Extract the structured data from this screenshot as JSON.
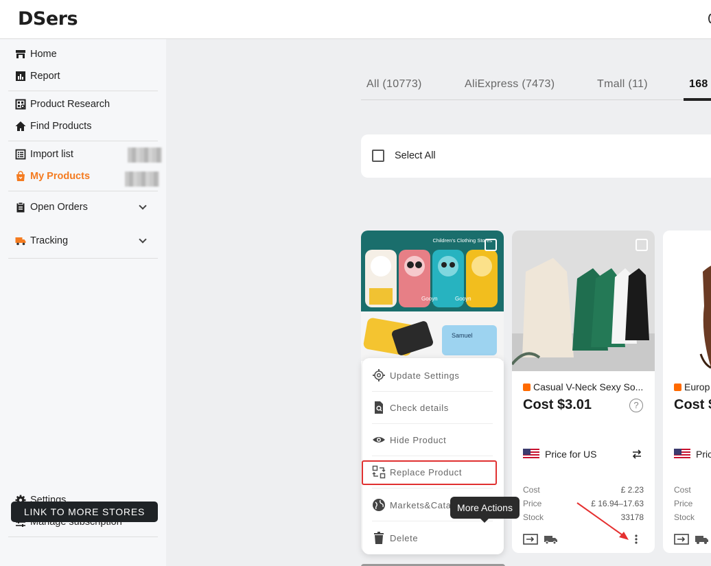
{
  "app": {
    "logo": "DSers"
  },
  "sidebar": {
    "items": [
      {
        "label": "Home",
        "icon": "store-icon"
      },
      {
        "label": "Report",
        "icon": "report-icon"
      },
      {
        "label": "Product Research",
        "icon": "research-icon"
      },
      {
        "label": "Find Products",
        "icon": "house-icon"
      },
      {
        "label": "Import list",
        "icon": "list-icon"
      },
      {
        "label": "My Products",
        "icon": "bag-icon",
        "active": true
      },
      {
        "label": "Open Orders",
        "icon": "clipboard-icon"
      },
      {
        "label": "Tracking",
        "icon": "truck-icon"
      }
    ],
    "settings_label": "Settings",
    "subscription_label": "Manage subscription",
    "link_stores_label": "LINK TO MORE STORES"
  },
  "tabs": [
    {
      "label": "All (10773)"
    },
    {
      "label": "AliExpress (7473)"
    },
    {
      "label": "Tmall (11)"
    },
    {
      "label": "168",
      "active": true
    }
  ],
  "toolbar": {
    "select_all_label": "Select All"
  },
  "menu": {
    "items": [
      {
        "label": "Update Settings",
        "icon": "gear-outline-icon"
      },
      {
        "label": "Check details",
        "icon": "document-search-icon"
      },
      {
        "label": "Hide Product",
        "icon": "eye-icon"
      },
      {
        "label": "Replace Product",
        "icon": "swap-icon"
      },
      {
        "label": "Markets&Cata",
        "icon": "globe-icon"
      },
      {
        "label": "Delete",
        "icon": "trash-icon"
      }
    ]
  },
  "tooltip": "More Actions",
  "cards": [
    {
      "image_caption": "Children's Clothing Stores",
      "image_stamp_brand": "Gooyn",
      "image_mask_name": "Samuel"
    },
    {
      "title": "Casual V-Neck Sexy So...",
      "cost": "Cost $3.01",
      "price_for": "Price for US",
      "cost_label": "Cost",
      "cost_value": "£ 2.23",
      "price_label": "Price",
      "price_value": "£ 16.94–17.63",
      "stock_label": "Stock",
      "stock_value": "33178"
    },
    {
      "title": "Europ",
      "cost": "Cost $",
      "price_for": "Pric",
      "cost_label": "Cost",
      "price_label": "Price",
      "stock_label": "Stock"
    }
  ],
  "colors": {
    "accent": "#f47b20",
    "highlight": "#e03030",
    "dark": "#1f2326"
  }
}
